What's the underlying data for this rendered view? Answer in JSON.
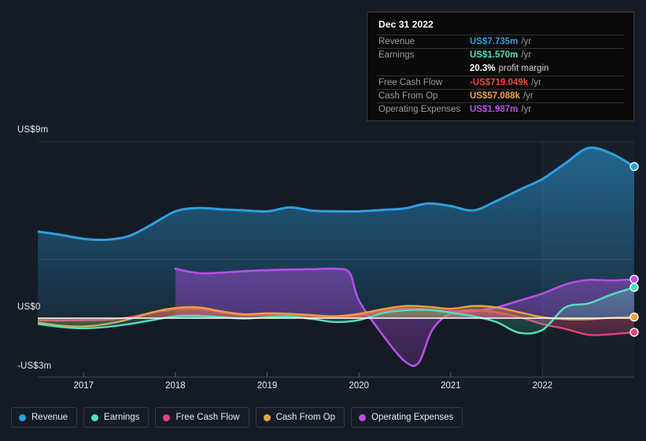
{
  "colors": {
    "background": "#151c26",
    "revenue": "#2e9fe0",
    "earnings": "#4fe0c0",
    "free_cash_flow": "#e0457b",
    "cash_from_op": "#e8a33d",
    "operating_expenses": "#b74fe8",
    "zero_line": "#ffffff",
    "grid": "#2b3441",
    "tooltip_background": "#0a0a0a",
    "tooltip_border": "#3c3c3c"
  },
  "tooltip": {
    "date": "Dec 31 2022",
    "rows": [
      {
        "label": "Revenue",
        "value": "US$7.735m",
        "unit": "/yr",
        "color": "#2e9fe0"
      },
      {
        "label": "Earnings",
        "value": "US$1.570m",
        "unit": "/yr",
        "color": "#4fe0c0"
      },
      {
        "label": "",
        "value": "20.3%",
        "unit": "profit margin",
        "color": "#ffffff"
      },
      {
        "label": "Free Cash Flow",
        "value": "-US$719.049k",
        "unit": "/yr",
        "color": "#f2453d"
      },
      {
        "label": "Cash From Op",
        "value": "US$57.088k",
        "unit": "/yr",
        "color": "#e8a33d"
      },
      {
        "label": "Operating Expenses",
        "value": "US$1.987m",
        "unit": "/yr",
        "color": "#b74fe8"
      }
    ]
  },
  "legend": {
    "items": [
      {
        "label": "Revenue",
        "color": "#2e9fe0"
      },
      {
        "label": "Earnings",
        "color": "#4fe0c0"
      },
      {
        "label": "Free Cash Flow",
        "color": "#e0457b"
      },
      {
        "label": "Cash From Op",
        "color": "#e8a33d"
      },
      {
        "label": "Operating Expenses",
        "color": "#b74fe8"
      }
    ]
  },
  "chart_data": {
    "type": "area",
    "title": "",
    "xlabel": "",
    "ylabel": "",
    "grid": true,
    "legend_position": "bottom",
    "y_ticks": [
      {
        "label": "US$9m",
        "value": 9
      },
      {
        "label": "US$0",
        "value": 0
      },
      {
        "label": "-US$3m",
        "value": -3
      }
    ],
    "ylim": [
      -3.4,
      9.4
    ],
    "x_ticks": [
      {
        "label": "2017",
        "value": 2017
      },
      {
        "label": "2018",
        "value": 2018
      },
      {
        "label": "2019",
        "value": 2019
      },
      {
        "label": "2020",
        "value": 2020
      },
      {
        "label": "2021",
        "value": 2021
      },
      {
        "label": "2022",
        "value": 2022
      }
    ],
    "xlim": [
      2016.5,
      2023.0
    ],
    "units": "US$ millions per year",
    "series": [
      {
        "name": "Revenue",
        "color": "#2e9fe0",
        "x": [
          2016.5,
          2016.75,
          2017.0,
          2017.25,
          2017.5,
          2017.75,
          2018.0,
          2018.25,
          2018.5,
          2018.75,
          2019.0,
          2019.25,
          2019.5,
          2019.75,
          2020.0,
          2020.25,
          2020.5,
          2020.75,
          2021.0,
          2021.25,
          2021.5,
          2021.75,
          2022.0,
          2022.25,
          2022.5,
          2022.75,
          2023.0
        ],
        "values": [
          4.42,
          4.25,
          4.05,
          4.0,
          4.2,
          4.8,
          5.45,
          5.62,
          5.55,
          5.5,
          5.45,
          5.65,
          5.48,
          5.45,
          5.45,
          5.52,
          5.6,
          5.85,
          5.72,
          5.5,
          5.98,
          6.55,
          7.1,
          7.9,
          8.68,
          8.4,
          7.735
        ]
      },
      {
        "name": "Earnings",
        "color": "#4fe0c0",
        "x": [
          2016.5,
          2016.75,
          2017.0,
          2017.25,
          2017.5,
          2017.75,
          2018.0,
          2018.25,
          2018.5,
          2018.75,
          2019.0,
          2019.25,
          2019.5,
          2019.75,
          2020.0,
          2020.25,
          2020.5,
          2020.75,
          2021.0,
          2021.25,
          2021.5,
          2021.75,
          2022.0,
          2022.25,
          2022.5,
          2022.75,
          2023.0
        ],
        "values": [
          -0.3,
          -0.45,
          -0.52,
          -0.45,
          -0.3,
          -0.1,
          0.1,
          0.12,
          0.05,
          -0.02,
          0.05,
          0.08,
          -0.05,
          -0.2,
          -0.1,
          0.25,
          0.4,
          0.42,
          0.28,
          0.1,
          -0.2,
          -0.75,
          -0.6,
          0.55,
          0.75,
          1.2,
          1.57
        ]
      },
      {
        "name": "Free Cash Flow",
        "color": "#e0457b",
        "x": [
          2016.5,
          2016.75,
          2017.0,
          2017.25,
          2017.5,
          2017.75,
          2018.0,
          2018.25,
          2018.5,
          2018.75,
          2019.0,
          2019.25,
          2019.5,
          2019.75,
          2020.0,
          2020.25,
          2020.5,
          2020.75,
          2021.0,
          2021.25,
          2021.5,
          2021.75,
          2022.0,
          2022.25,
          2022.5,
          2022.75,
          2023.0
        ],
        "values": [
          -0.1,
          -0.12,
          -0.1,
          -0.08,
          0.05,
          0.28,
          0.45,
          0.48,
          0.3,
          0.15,
          0.18,
          0.15,
          0.1,
          0.05,
          0.12,
          0.35,
          0.5,
          0.45,
          0.35,
          0.42,
          0.3,
          0.05,
          -0.3,
          -0.55,
          -0.85,
          -0.82,
          -0.719
        ]
      },
      {
        "name": "Cash From Op",
        "color": "#e8a33d",
        "x": [
          2016.5,
          2016.75,
          2017.0,
          2017.25,
          2017.5,
          2017.75,
          2018.0,
          2018.25,
          2018.5,
          2018.75,
          2019.0,
          2019.25,
          2019.5,
          2019.75,
          2020.0,
          2020.25,
          2020.5,
          2020.75,
          2021.0,
          2021.25,
          2021.5,
          2021.75,
          2022.0,
          2022.25,
          2022.5,
          2022.75,
          2023.0
        ],
        "values": [
          -0.22,
          -0.38,
          -0.42,
          -0.3,
          -0.05,
          0.3,
          0.52,
          0.55,
          0.35,
          0.2,
          0.25,
          0.22,
          0.15,
          0.1,
          0.22,
          0.45,
          0.62,
          0.58,
          0.48,
          0.62,
          0.55,
          0.3,
          0.05,
          -0.05,
          -0.05,
          0.02,
          0.057
        ]
      },
      {
        "name": "Operating Expenses",
        "color": "#b74fe8",
        "x": [
          2018.0,
          2018.25,
          2018.5,
          2018.75,
          2019.0,
          2019.25,
          2019.5,
          2019.75,
          2019.9,
          2020.0,
          2020.25,
          2020.5,
          2020.65,
          2020.8,
          2021.0,
          2021.25,
          2021.5,
          2021.75,
          2022.0,
          2022.25,
          2022.5,
          2022.75,
          2023.0
        ],
        "values": [
          2.52,
          2.3,
          2.32,
          2.4,
          2.45,
          2.48,
          2.5,
          2.52,
          2.3,
          0.9,
          -0.8,
          -2.2,
          -2.28,
          -0.6,
          0.25,
          0.35,
          0.55,
          0.9,
          1.25,
          1.72,
          1.95,
          1.92,
          1.987
        ]
      }
    ]
  }
}
